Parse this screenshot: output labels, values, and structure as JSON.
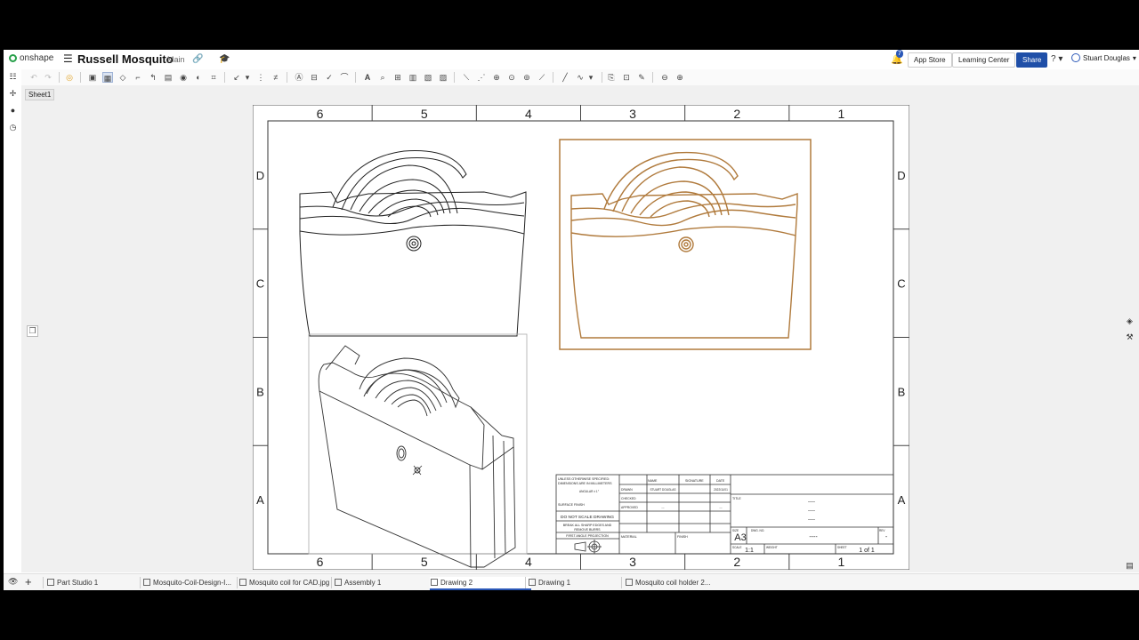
{
  "app": {
    "logo_text": "onshape",
    "document_title": "Russell Mosquito",
    "branch": "Main"
  },
  "header": {
    "notifications_count": "7",
    "app_store": "App Store",
    "learning_center": "Learning Center",
    "share": "Share",
    "help_icon": "?",
    "user_name": "Stuart Douglas"
  },
  "sheet_tab": "Sheet1",
  "drawing": {
    "zone_columns": [
      "6",
      "5",
      "4",
      "3",
      "2",
      "1"
    ],
    "zone_rows": [
      "D",
      "C",
      "B",
      "A"
    ],
    "title_block": {
      "notes": [
        "UNLESS OTHERWISE SPECIFIED:",
        "DIMENSIONS ARE IN MILLIMETERS",
        "ANGULAR ± 1°"
      ],
      "surface_finish": "SURFACE FINISH",
      "do_not_scale": "DO NOT SCALE DRAWING",
      "break_edges_1": "BREAK ALL SHARP EDGES AND",
      "break_edges_2": "REMOVE BURRS",
      "projection": "FIRST ANGLE PROJECTION",
      "col_name": "NAME",
      "col_signature": "SIGNATURE",
      "col_date": "DATE",
      "row_drawn": "DRAWN",
      "row_checked": "CHECKED",
      "row_approved": "APPROVED",
      "drawn_name": "STUART DOUGLAS",
      "drawn_date": "2022/11/01",
      "approved_name": "---",
      "approved_date": "---",
      "title_label": "TITLE",
      "title_values": [
        "----",
        "----",
        "----"
      ],
      "material": "MATERIAL",
      "finish": "FINISH",
      "size_label": "SIZE",
      "size": "A3",
      "dwg_no_label": "DWG. NO.",
      "dwg_no": "----",
      "rev_label": "REV",
      "rev": "-",
      "scale_label": "SCALE",
      "scale": "1:1",
      "weight_label": "WEIGHT",
      "sheet_label": "SHEET",
      "sheet_value": "1 of 1"
    }
  },
  "bottom_tabs": [
    "Part Studio 1",
    "Mosquito-Coil-Design-I...",
    "Mosquito coil for CAD.jpg",
    "Assembly 1",
    "Drawing 2",
    "Drawing 1",
    "Mosquito coil holder 2..."
  ],
  "active_tab": "Drawing 2",
  "colors": {
    "accent": "#2b58b8",
    "selection": "#b07a3c",
    "onshape_green": "#27a04a"
  }
}
